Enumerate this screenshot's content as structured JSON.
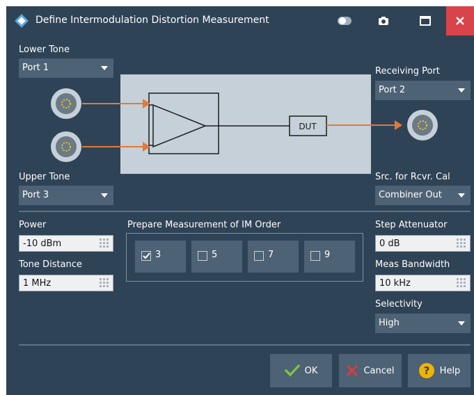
{
  "window": {
    "title": "Define Intermodulation Distortion Measurement"
  },
  "lower_tone": {
    "label": "Lower Tone",
    "value": "Port 1"
  },
  "upper_tone": {
    "label": "Upper Tone",
    "value": "Port 3"
  },
  "receiving_port": {
    "label": "Receiving Port",
    "value": "Port 2"
  },
  "src_rcvr_cal": {
    "label": "Src. for Rcvr. Cal",
    "value": "Combiner Out"
  },
  "diagram": {
    "dut_label": "DUT"
  },
  "power": {
    "label": "Power",
    "value": "-10 dBm"
  },
  "tone_distance": {
    "label": "Tone Distance",
    "value": "1 MHz"
  },
  "im_order": {
    "label": "Prepare Measurement of IM Order",
    "options": [
      {
        "label": "3",
        "checked": true
      },
      {
        "label": "5",
        "checked": false
      },
      {
        "label": "7",
        "checked": false
      },
      {
        "label": "9",
        "checked": false
      }
    ]
  },
  "step_attenuator": {
    "label": "Step Attenuator",
    "value": "0 dB"
  },
  "meas_bandwidth": {
    "label": "Meas Bandwidth",
    "value": "10 kHz"
  },
  "selectivity": {
    "label": "Selectivity",
    "value": "High"
  },
  "buttons": {
    "ok": "OK",
    "cancel": "Cancel",
    "help": "Help"
  },
  "colors": {
    "background": "#2f4356",
    "combo": "#4e6275",
    "accent_arrow": "#e07b39",
    "close": "#d9434a",
    "ok_check": "#7cc242",
    "cancel_x": "#e23a3a",
    "help": "#f0b400"
  }
}
